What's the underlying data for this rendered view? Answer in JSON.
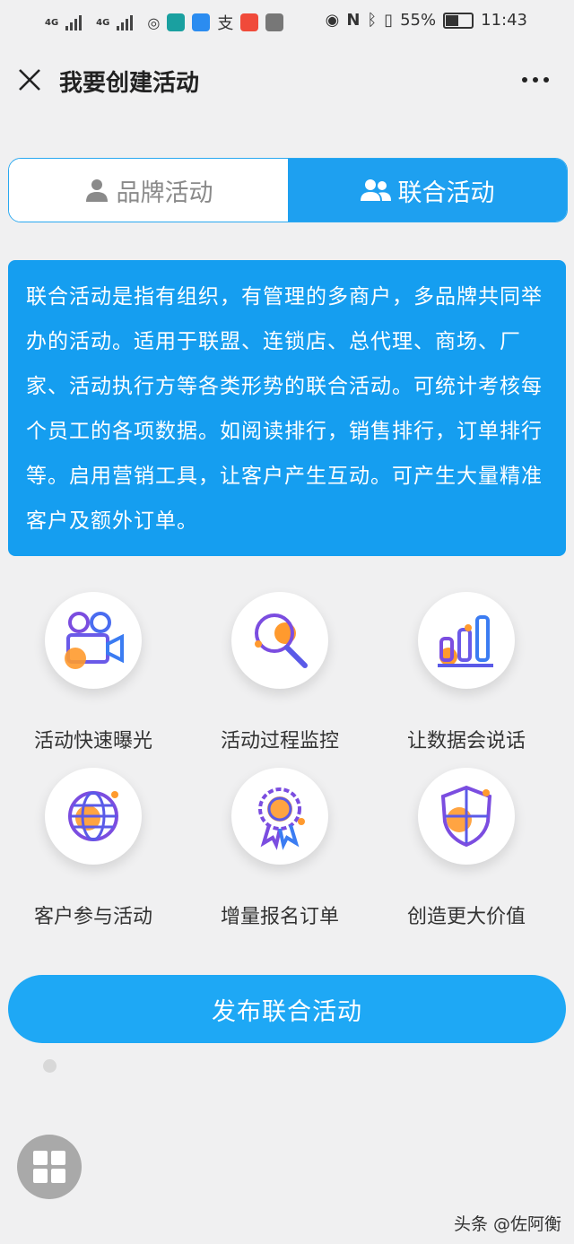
{
  "status_bar": {
    "battery": "55%",
    "time": "11:43",
    "network_1": "4G",
    "network_2": "4G"
  },
  "navbar": {
    "title": "我要创建活动"
  },
  "tabs": [
    {
      "label": "品牌活动",
      "active": false
    },
    {
      "label": "联合活动",
      "active": true
    }
  ],
  "description": "联合活动是指有组织，有管理的多商户，多品牌共同举办的活动。适用于联盟、连锁店、总代理、商场、厂家、活动执行方等各类形势的联合活动。可统计考核每个员工的各项数据。如阅读排行，销售排行，订单排行等。启用营销工具，让客户产生互动。可产生大量精准客户及额外订单。",
  "features": [
    {
      "label": "活动快速曝光",
      "icon": "video-camera-icon"
    },
    {
      "label": "活动过程监控",
      "icon": "magnifier-icon"
    },
    {
      "label": "让数据会说话",
      "icon": "bar-chart-icon"
    },
    {
      "label": "客户参与活动",
      "icon": "globe-icon"
    },
    {
      "label": "增量报名订单",
      "icon": "award-badge-icon"
    },
    {
      "label": "创造更大价值",
      "icon": "shield-icon"
    }
  ],
  "publish_button": "发布联合活动",
  "watermark": "头条 @佐阿衡",
  "colors": {
    "primary": "#1ea0f0",
    "accent_orange": "#ff9a2e",
    "icon_purple": "#7b4de0"
  }
}
